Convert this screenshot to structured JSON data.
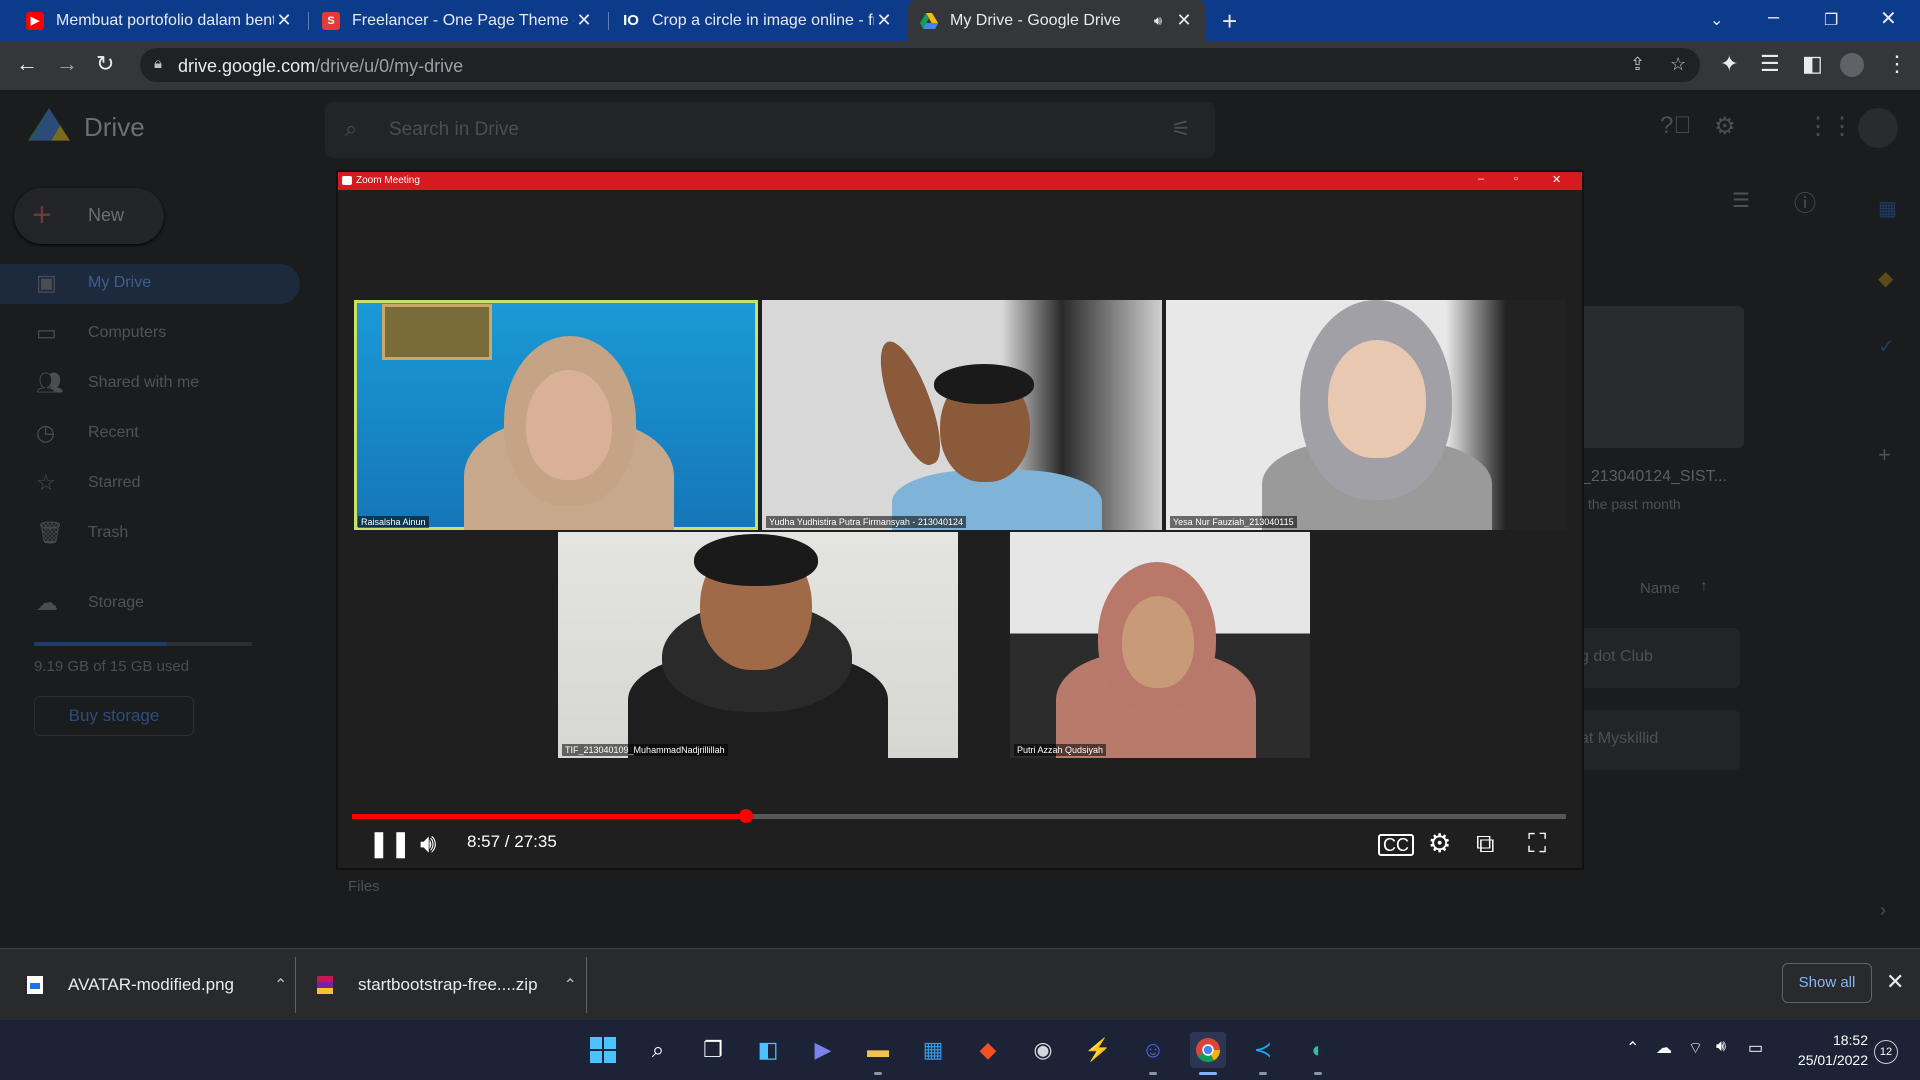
{
  "browser": {
    "tabs": [
      {
        "title": "Membuat portofolio dalam bentu",
        "favicon": "youtube-icon",
        "active": false
      },
      {
        "title": "Freelancer - One Page Theme - S",
        "favicon": "s-logo-icon",
        "active": false
      },
      {
        "title": "Crop a circle in image online - fre",
        "favicon": "io-logo-icon",
        "active": false
      },
      {
        "title": "My Drive - Google Drive",
        "favicon": "drive-icon",
        "active": true
      }
    ],
    "url_host": "drive.google.com",
    "url_path": "/drive/u/0/my-drive"
  },
  "drive": {
    "app_name": "Drive",
    "search_placeholder": "Search in Drive",
    "new_label": "New",
    "nav": [
      {
        "label": "My Drive",
        "icon": "my-drive-icon",
        "selected": true
      },
      {
        "label": "Computers",
        "icon": "computer-icon",
        "selected": false
      },
      {
        "label": "Shared with me",
        "icon": "people-icon",
        "selected": false
      },
      {
        "label": "Recent",
        "icon": "clock-icon",
        "selected": false
      },
      {
        "label": "Starred",
        "icon": "star-icon",
        "selected": false
      },
      {
        "label": "Trash",
        "icon": "trash-icon",
        "selected": false
      }
    ],
    "storage_label": "Storage",
    "storage_used": "9.19 GB of 15 GB used",
    "storage_fraction": 0.61,
    "buy_storage": "Buy storage",
    "files_label": "Files",
    "file_name_partial": "_213040124_SIST...",
    "file_meta_partial": "the past month",
    "sort_label": "Name",
    "folder1_partial": "g dot Club",
    "folder2_partial": "at Myskillid"
  },
  "video": {
    "zoom_title": "Zoom Meeting",
    "participants": [
      {
        "name": "Raisalsha Ainun"
      },
      {
        "name": "Yudha Yudhistira Putra Firmansyah - 213040124"
      },
      {
        "name": "Yesa Nur Fauziah_213040115"
      },
      {
        "name": "TIF_213040109_MuhammadNadjrillillah"
      },
      {
        "name": "Putri Azzah Qudsiyah"
      }
    ],
    "current_time": "8:57",
    "duration": "27:35",
    "time_display": "8:57 / 27:35",
    "progress_fraction": 0.3245
  },
  "downloads": {
    "items": [
      {
        "name": "AVATAR-modified.png"
      },
      {
        "name": "startbootstrap-free....zip"
      }
    ],
    "show_all": "Show all"
  },
  "taskbar": {
    "time": "18:52",
    "date": "25/01/2022",
    "notifications": "12"
  },
  "colors": {
    "tabstrip": "#0d3b8c",
    "zoom_bar": "#d71920",
    "progress": "#ff0000",
    "link": "#8ab4f8"
  }
}
